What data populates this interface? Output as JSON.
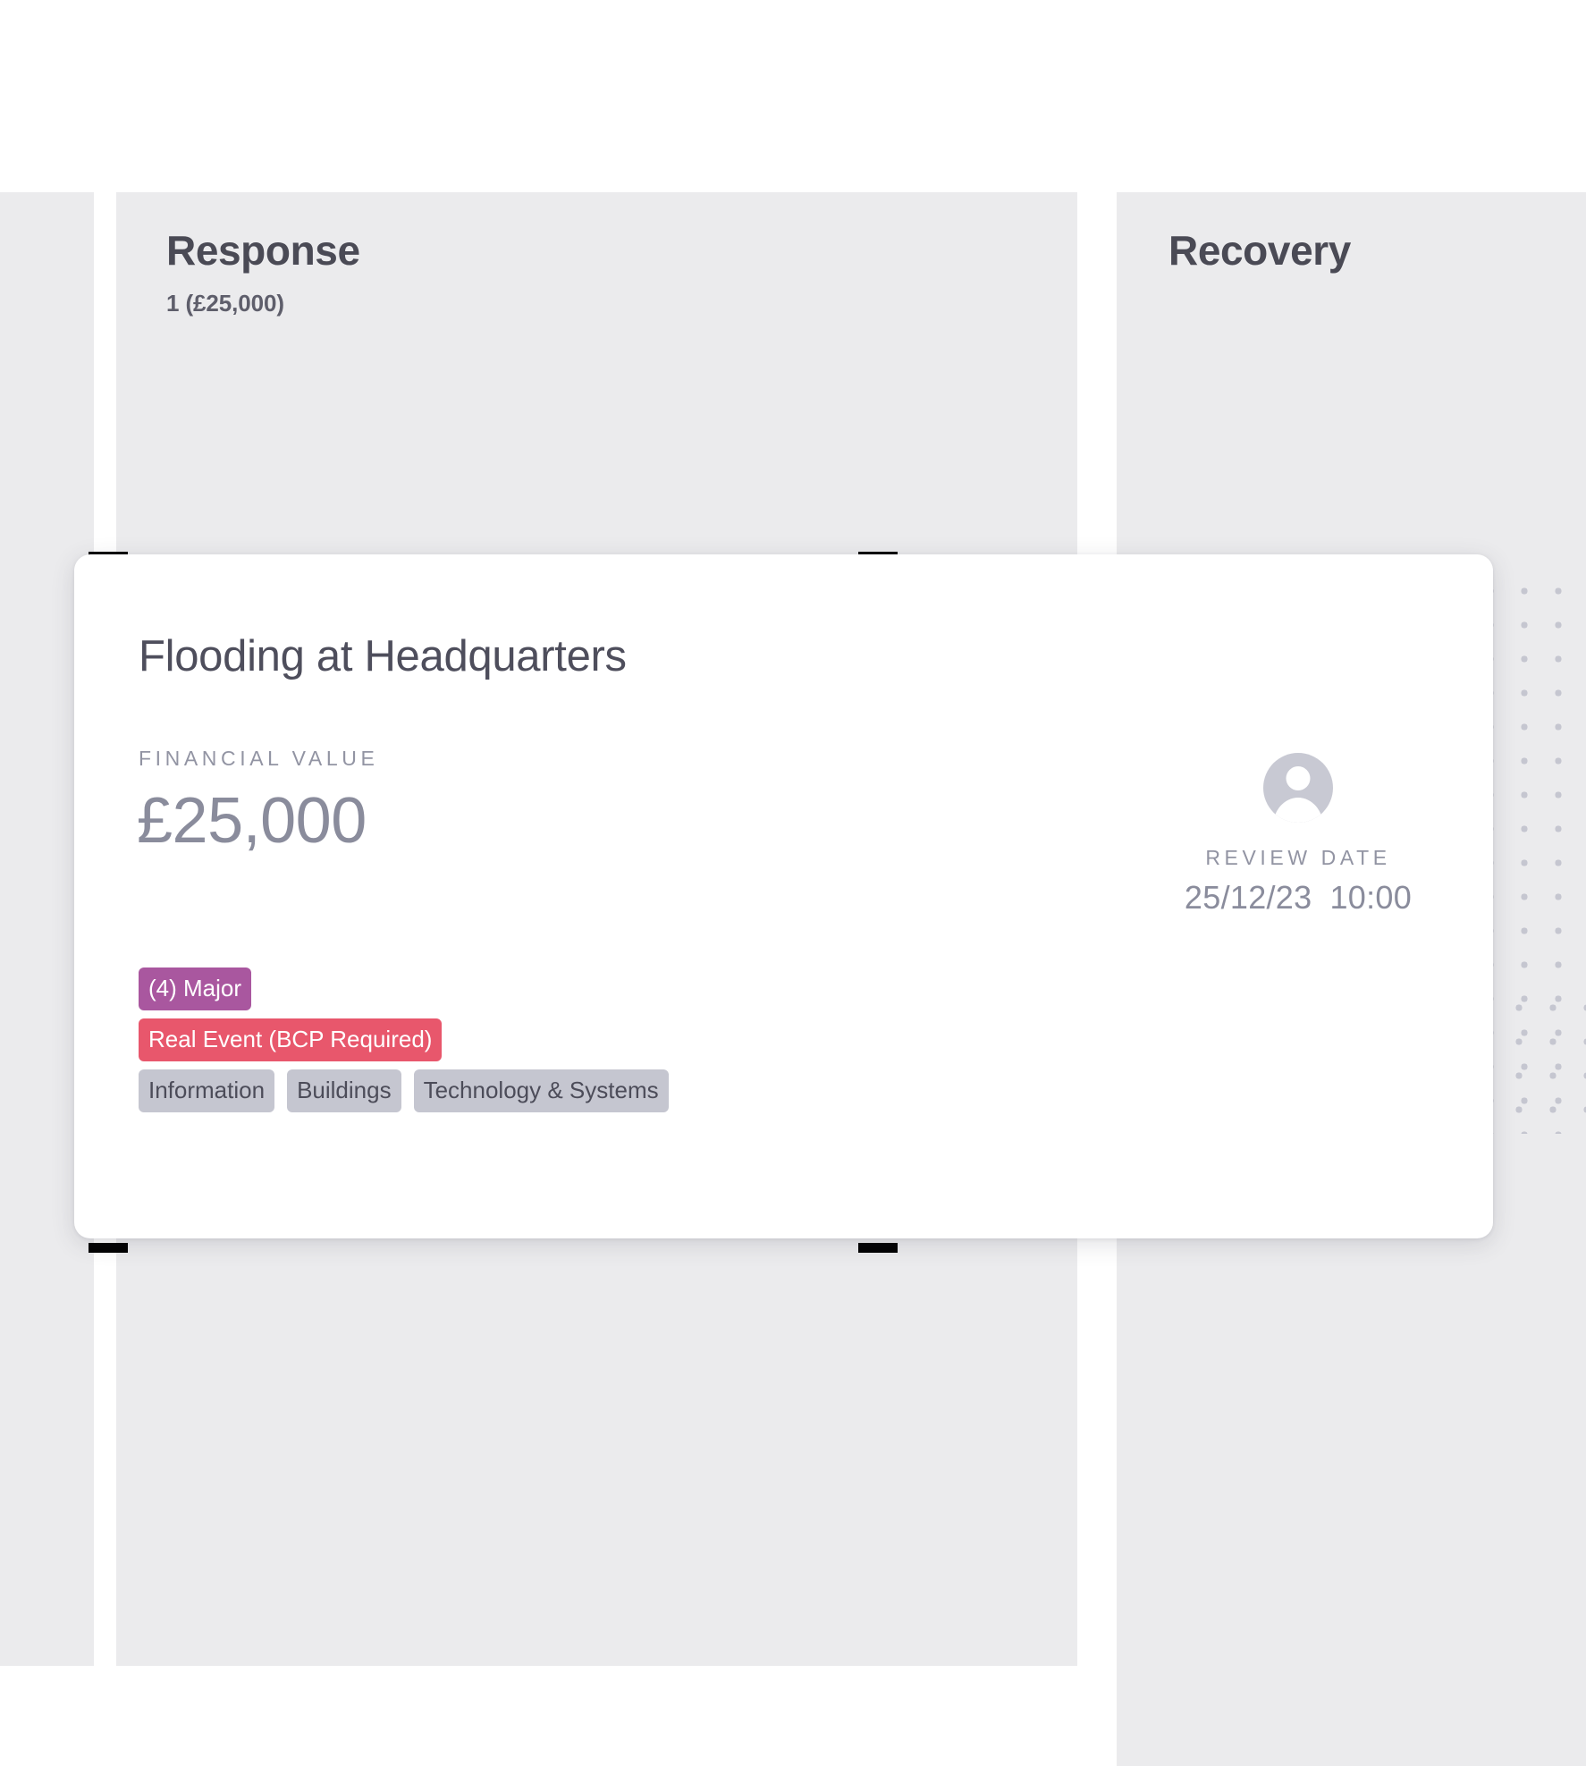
{
  "board": {
    "columns": [
      {
        "name": "preparation",
        "title": "",
        "count": ""
      },
      {
        "name": "response",
        "title": "Response",
        "count": "1 (£25,000)"
      },
      {
        "name": "recovery",
        "title": "Recovery",
        "count": ""
      }
    ]
  },
  "card": {
    "title": "Flooding at Headquarters",
    "financial": {
      "label": "Financial Value",
      "value": "£25,000"
    },
    "tags": {
      "severity": "(4) Major",
      "event_type": "Real Event (BCP Required)",
      "categories": [
        "Information",
        "Buildings",
        "Technology & Systems"
      ]
    },
    "review": {
      "label": "Review Date",
      "date": "25/12/23",
      "time": "10:00"
    },
    "avatar_icon": "user-avatar-icon"
  },
  "colors": {
    "column_bg": "#ebebed",
    "card_bg": "#ffffff",
    "severity_purple": "#a9579f",
    "event_red": "#e8576c",
    "category_gray": "#c5c6d0",
    "heading_text": "#4a4a55",
    "muted_text": "#8a8c9c",
    "drop_marker": "#000000"
  }
}
